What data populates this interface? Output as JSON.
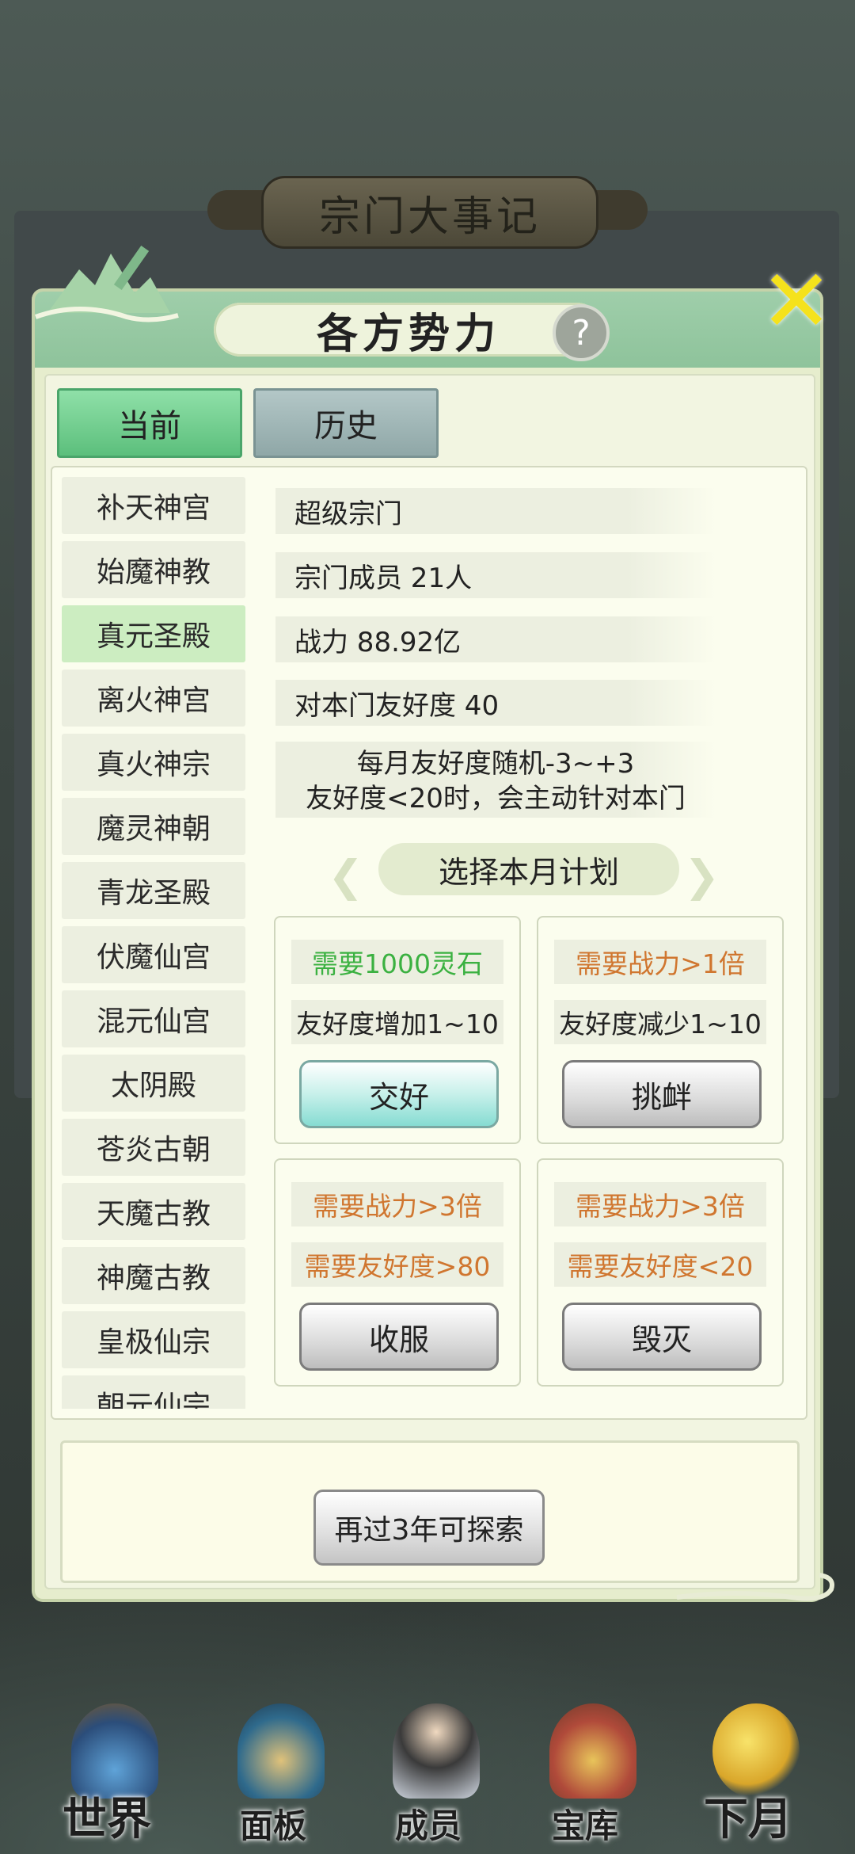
{
  "background_title": "宗门大事记",
  "dialog": {
    "title": "各方势力",
    "help_icon": "help-icon",
    "close_icon": "close-icon"
  },
  "tabs": {
    "current": "当前",
    "history": "历史"
  },
  "sects": [
    "补天神宫",
    "始魔神教",
    "真元圣殿",
    "离火神宫",
    "真火神宗",
    "魔灵神朝",
    "青龙圣殿",
    "伏魔仙宫",
    "混元仙宫",
    "太阴殿",
    "苍炎古朝",
    "天魔古教",
    "神魔古教",
    "皇极仙宗",
    "朝元仙宗"
  ],
  "selected_sect_index": 2,
  "info": {
    "level": "超级宗门",
    "members": "宗门成员 21人",
    "power": "战力 88.92亿",
    "friendship": "对本门友好度 40",
    "note_line1": "每月友好度随机-3~+3",
    "note_line2": "友好度<20时，会主动针对本门"
  },
  "plan_title": "选择本月计划",
  "actions": [
    {
      "req1": "需要1000灵石",
      "req2": "友好度增加1~10",
      "button": "交好"
    },
    {
      "req1": "需要战力>1倍",
      "req2": "友好度减少1~10",
      "button": "挑衅"
    },
    {
      "req1": "需要战力>3倍",
      "req2": "需要友好度>80",
      "button": "收服"
    },
    {
      "req1": "需要战力>3倍",
      "req2": "需要友好度<20",
      "button": "毁灭"
    }
  ],
  "explore_button": "再过3年可探索",
  "nav": [
    {
      "label": "世界",
      "icon": "world-icon"
    },
    {
      "label": "面板",
      "icon": "panel-icon"
    },
    {
      "label": "成员",
      "icon": "members-icon"
    },
    {
      "label": "宝库",
      "icon": "treasury-icon"
    },
    {
      "label": "下月",
      "icon": "next-month-icon"
    }
  ],
  "colors": {
    "green_text": "#3bb141",
    "orange_text": "#d0762f",
    "dialog_bg": "#e6edcd"
  }
}
